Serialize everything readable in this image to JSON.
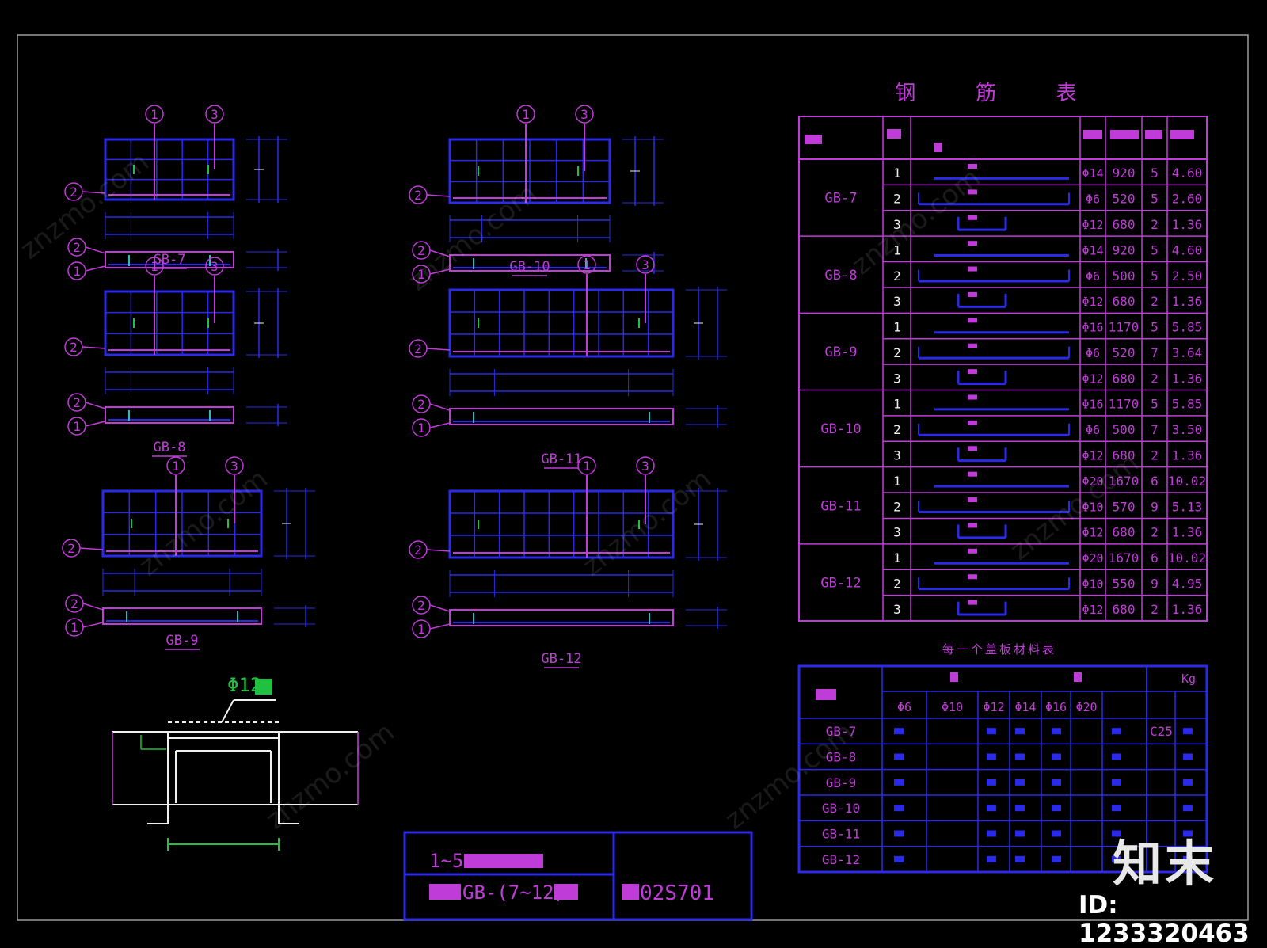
{
  "drawing": {
    "panels": [
      {
        "name": "GB-7"
      },
      {
        "name": "GB-8"
      },
      {
        "name": "GB-9"
      },
      {
        "name": "GB-10"
      },
      {
        "name": "GB-11"
      },
      {
        "name": "GB-12"
      }
    ],
    "callouts": {
      "one": "1",
      "two": "2",
      "three": "3"
    },
    "detail": {
      "rebar_label": "Φ12"
    },
    "title_block": {
      "line1": "1~5",
      "line2": "GB-(7~12)",
      "code": "02S701"
    }
  },
  "rebar_table": {
    "title": "钢 筋 表",
    "rows": [
      {
        "name": "GB-7",
        "items": [
          {
            "no": "1",
            "dia": "Φ14",
            "len": "920",
            "n": "5",
            "w": "4.60"
          },
          {
            "no": "2",
            "dia": "Φ6",
            "len": "520",
            "n": "5",
            "w": "2.60"
          },
          {
            "no": "3",
            "dia": "Φ12",
            "len": "680",
            "n": "2",
            "w": "1.36"
          }
        ]
      },
      {
        "name": "GB-8",
        "items": [
          {
            "no": "1",
            "dia": "Φ14",
            "len": "920",
            "n": "5",
            "w": "4.60"
          },
          {
            "no": "2",
            "dia": "Φ6",
            "len": "500",
            "n": "5",
            "w": "2.50"
          },
          {
            "no": "3",
            "dia": "Φ12",
            "len": "680",
            "n": "2",
            "w": "1.36"
          }
        ]
      },
      {
        "name": "GB-9",
        "items": [
          {
            "no": "1",
            "dia": "Φ16",
            "len": "1170",
            "n": "5",
            "w": "5.85"
          },
          {
            "no": "2",
            "dia": "Φ6",
            "len": "520",
            "n": "7",
            "w": "3.64"
          },
          {
            "no": "3",
            "dia": "Φ12",
            "len": "680",
            "n": "2",
            "w": "1.36"
          }
        ]
      },
      {
        "name": "GB-10",
        "items": [
          {
            "no": "1",
            "dia": "Φ16",
            "len": "1170",
            "n": "5",
            "w": "5.85"
          },
          {
            "no": "2",
            "dia": "Φ6",
            "len": "500",
            "n": "7",
            "w": "3.50"
          },
          {
            "no": "3",
            "dia": "Φ12",
            "len": "680",
            "n": "2",
            "w": "1.36"
          }
        ]
      },
      {
        "name": "GB-11",
        "items": [
          {
            "no": "1",
            "dia": "Φ20",
            "len": "1670",
            "n": "6",
            "w": "10.02"
          },
          {
            "no": "2",
            "dia": "Φ10",
            "len": "570",
            "n": "9",
            "w": "5.13"
          },
          {
            "no": "3",
            "dia": "Φ12",
            "len": "680",
            "n": "2",
            "w": "1.36"
          }
        ]
      },
      {
        "name": "GB-12",
        "items": [
          {
            "no": "1",
            "dia": "Φ20",
            "len": "1670",
            "n": "6",
            "w": "10.02"
          },
          {
            "no": "2",
            "dia": "Φ10",
            "len": "550",
            "n": "9",
            "w": "4.95"
          },
          {
            "no": "3",
            "dia": "Φ12",
            "len": "680",
            "n": "2",
            "w": "1.36"
          }
        ]
      }
    ]
  },
  "material_table": {
    "title": "每一个盖板材料表",
    "header_kg": "Kg",
    "dias": [
      "Φ6",
      "Φ10",
      "Φ12",
      "Φ14",
      "Φ16",
      "Φ20"
    ],
    "grade": "C25",
    "rows": [
      "GB-7",
      "GB-8",
      "GB-9",
      "GB-10",
      "GB-11",
      "GB-12"
    ]
  },
  "brand": {
    "name": "知末",
    "id": "ID: 1233320463",
    "watermark": "znzmo.com"
  },
  "colors": {
    "line": "#c03cd8",
    "blue": "#2a2ae8",
    "white": "#f0f0f0",
    "green": "#20c040",
    "frame": "#9a9a9a"
  }
}
